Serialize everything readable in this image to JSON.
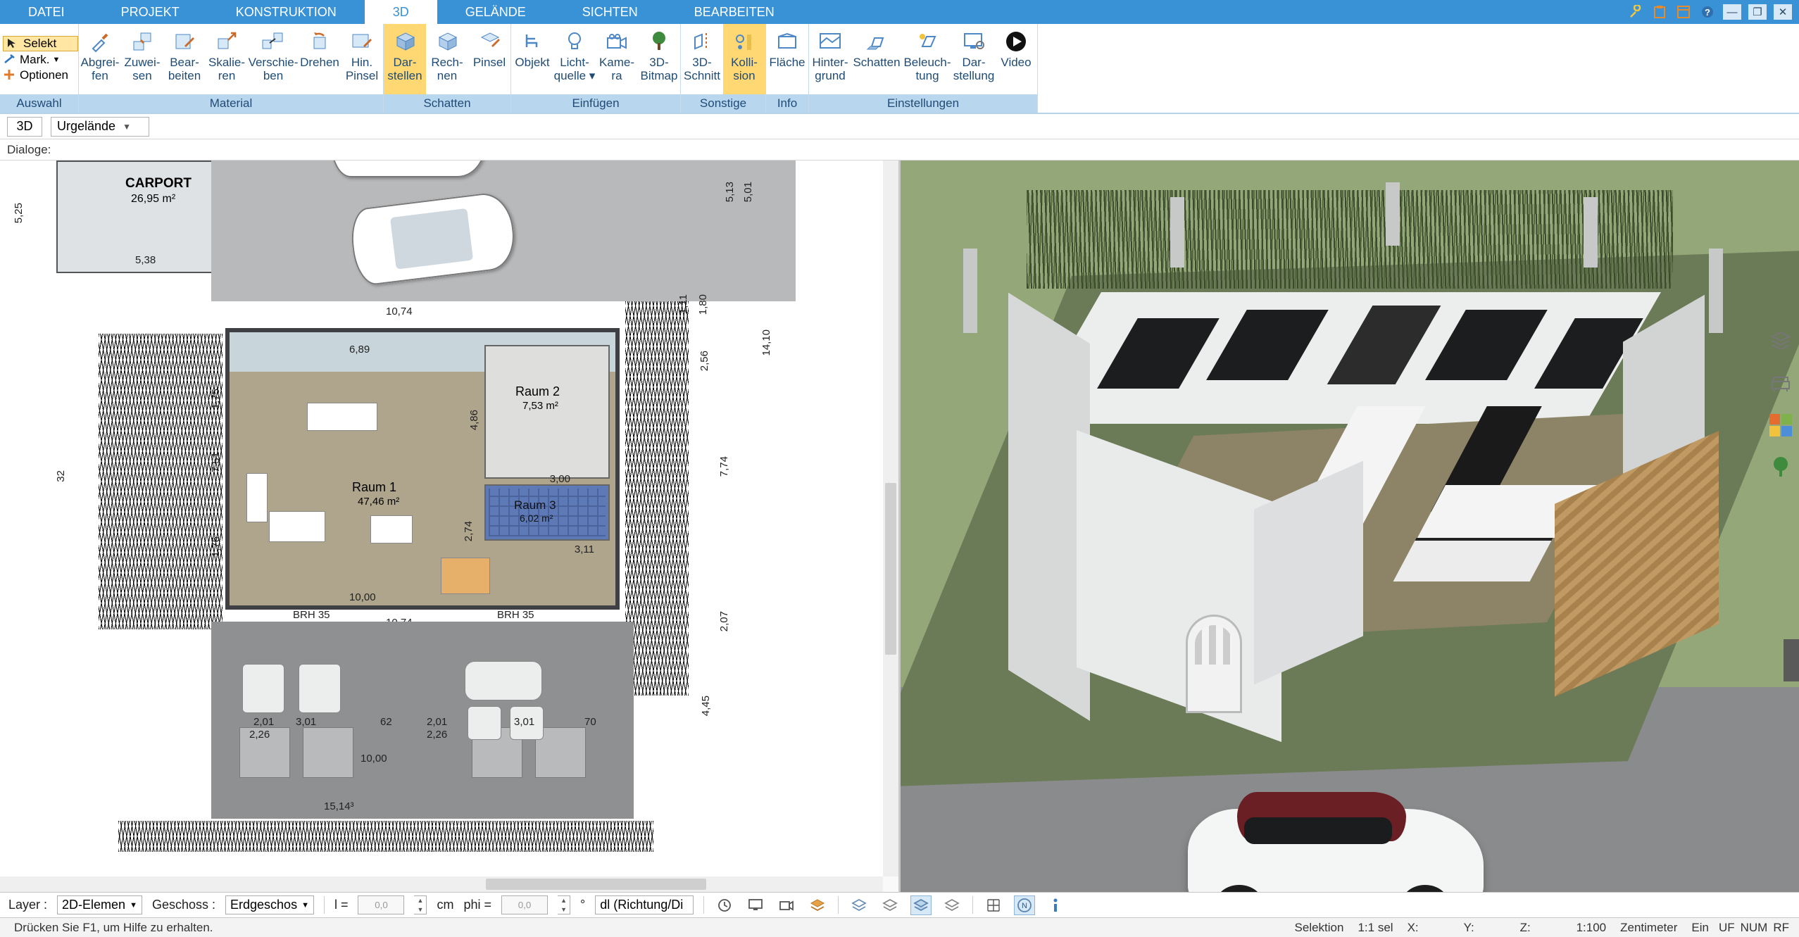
{
  "menu": {
    "tabs": [
      "DATEI",
      "PROJEKT",
      "KONSTRUKTION",
      "3D",
      "GELÄNDE",
      "SICHTEN",
      "BEARBEITEN"
    ],
    "active": 3
  },
  "selection_panel": {
    "select": "Selekt",
    "mark": "Mark.",
    "options": "Optionen",
    "group_label": "Auswahl"
  },
  "ribbon_groups": [
    {
      "label": "Material",
      "buttons": [
        {
          "id": "abgreifen",
          "line1": "Abgrei-",
          "line2": "fen"
        },
        {
          "id": "zuweisen",
          "line1": "Zuwei-",
          "line2": "sen"
        },
        {
          "id": "bearbeiten",
          "line1": "Bear-",
          "line2": "beiten"
        },
        {
          "id": "skalieren",
          "line1": "Skalie-",
          "line2": "ren"
        },
        {
          "id": "verschieben",
          "line1": "Verschie-",
          "line2": "ben"
        },
        {
          "id": "drehen",
          "line1": "Drehen",
          "line2": ""
        },
        {
          "id": "hin-pinsel",
          "line1": "Hin.",
          "line2": "Pinsel"
        }
      ]
    },
    {
      "label": "Schatten",
      "buttons": [
        {
          "id": "darstellen",
          "line1": "Dar-",
          "line2": "stellen",
          "active": true
        },
        {
          "id": "rechnen",
          "line1": "Rech-",
          "line2": "nen"
        },
        {
          "id": "pinsel",
          "line1": "Pinsel",
          "line2": ""
        }
      ]
    },
    {
      "label": "Einfügen",
      "buttons": [
        {
          "id": "objekt",
          "line1": "Objekt",
          "line2": ""
        },
        {
          "id": "lichtquelle",
          "line1": "Licht-",
          "line2": "quelle ▾"
        },
        {
          "id": "kamera",
          "line1": "Kame-",
          "line2": "ra"
        },
        {
          "id": "3d-bitmap",
          "line1": "3D-",
          "line2": "Bitmap"
        }
      ]
    },
    {
      "label": "Sonstige",
      "buttons": [
        {
          "id": "3d-schnitt",
          "line1": "3D-",
          "line2": "Schnitt"
        },
        {
          "id": "kollision",
          "line1": "Kolli-",
          "line2": "sion",
          "active": true
        }
      ]
    },
    {
      "label": "Info",
      "buttons": [
        {
          "id": "flaeche",
          "line1": "Fläche",
          "line2": ""
        }
      ]
    },
    {
      "label": "Einstellungen",
      "buttons": [
        {
          "id": "hintergrund",
          "line1": "Hinter-",
          "line2": "grund"
        },
        {
          "id": "schatten",
          "line1": "Schatten",
          "line2": ""
        },
        {
          "id": "beleuchtung",
          "line1": "Beleuch-",
          "line2": "tung"
        },
        {
          "id": "darstellung",
          "line1": "Dar-",
          "line2": "stellung"
        },
        {
          "id": "video",
          "line1": "Video",
          "line2": ""
        }
      ]
    }
  ],
  "combo": {
    "mode": "3D",
    "terrain": "Urgelände"
  },
  "dialoge_label": "Dialoge:",
  "plan": {
    "carport": {
      "title": "CARPORT",
      "area": "26,95 m²",
      "dim_bottom": "5,38"
    },
    "rooms": {
      "r1": {
        "name": "Raum 1",
        "area": "47,46 m²"
      },
      "r2": {
        "name": "Raum 2",
        "area": "7,53 m²"
      },
      "r3": {
        "name": "Raum 3",
        "area": "6,02 m²"
      }
    },
    "dims": {
      "d_10_74": "10,74",
      "d_5_13": "5,13",
      "d_5_01": "5,01",
      "d_14_10": "14,10",
      "d_2_56": "2,56",
      "d_7_74": "7,74",
      "d_1_11": "1,11",
      "d_1_80": "1,80",
      "d_5_25": "5,25",
      "d_6_89": "6,89",
      "d_4_86": "4,86",
      "d_10_00": "10,00",
      "d_2_74": "2,74",
      "d_3_00": "3,00",
      "d_3_11": "3,11",
      "d_1_76": "1,76",
      "d_1_75": "1,75",
      "d_7_51": "7,51",
      "d_2_01": "2,01",
      "d_2_26": "2,26",
      "d_3_01": "3,01",
      "d_62": "62",
      "d_70": "70",
      "d_4_45": "4,45",
      "d_15_14": "15,14³",
      "d_2_07": "2,07",
      "brh": "BRH 35",
      "d_32": "32"
    }
  },
  "optbar": {
    "layer_label": "Layer :",
    "layer_value": "2D-Elemen",
    "floor_label": "Geschoss :",
    "floor_value": "Erdgeschos",
    "l_label": "l =",
    "l_value": "0,0",
    "l_unit": "cm",
    "phi_label": "phi =",
    "phi_value": "0,0",
    "phi_unit": "°",
    "snap": "dl (Richtung/Di"
  },
  "status": {
    "help": "Drücken Sie F1, um Hilfe zu erhalten.",
    "mode": "Selektion",
    "sel": "1:1 sel",
    "x": "X:",
    "y": "Y:",
    "z": "Z:",
    "scale": "1:100",
    "unit": "Zentimeter",
    "ins": "Ein",
    "uf": "UF",
    "num": "NUM",
    "rf": "RF"
  }
}
